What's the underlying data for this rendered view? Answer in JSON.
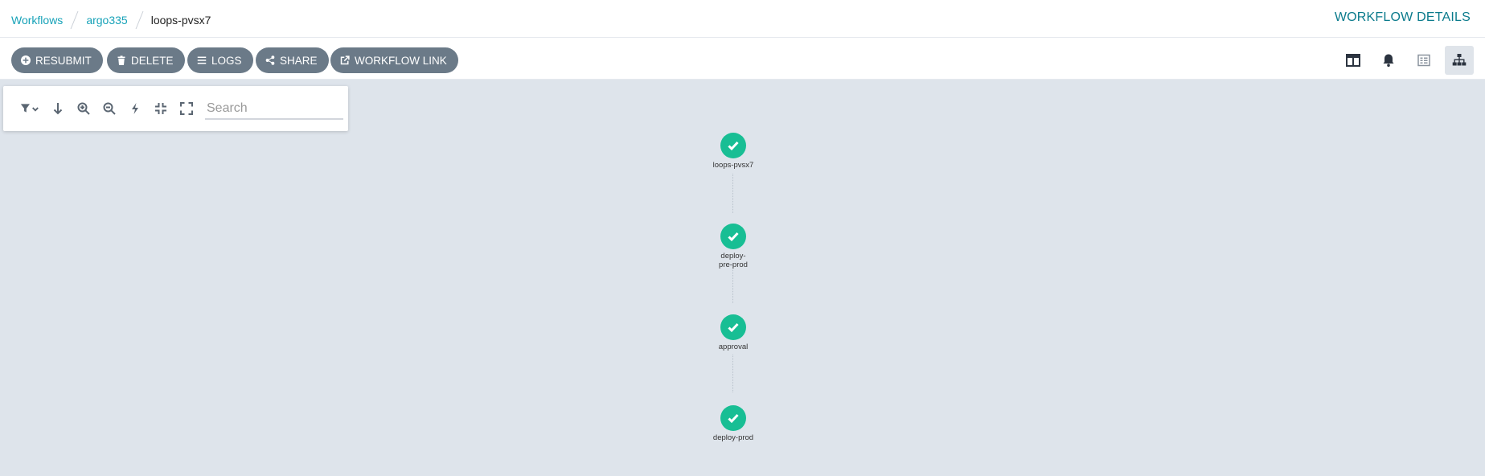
{
  "breadcrumb": {
    "items": [
      "Workflows",
      "argo335"
    ],
    "current": "loops-pvsx7"
  },
  "page_title": "WORKFLOW DETAILS",
  "toolbar": {
    "buttons": [
      {
        "label": "RESUBMIT",
        "icon": "plus-circle-icon"
      },
      {
        "label": "DELETE",
        "icon": "trash-icon"
      },
      {
        "label": "LOGS",
        "icon": "bars-icon"
      },
      {
        "label": "SHARE",
        "icon": "share-icon"
      },
      {
        "label": "WORKFLOW LINK",
        "icon": "external-link-icon"
      }
    ],
    "views": [
      {
        "name": "summary-view",
        "icon": "columns-icon",
        "active": false
      },
      {
        "name": "events-view",
        "icon": "bell-icon",
        "active": false
      },
      {
        "name": "timeline-view",
        "icon": "list-alt-icon",
        "active": false
      },
      {
        "name": "graph-view",
        "icon": "sitemap-icon",
        "active": true
      }
    ]
  },
  "graph_panel": {
    "icons": [
      "filter-icon",
      "arrow-down-icon",
      "zoom-in-icon",
      "zoom-out-icon",
      "bolt-icon",
      "compress-icon",
      "expand-icon"
    ],
    "search_placeholder": "Search"
  },
  "nodes": [
    {
      "label": "loops-pvsx7",
      "status": "succeeded"
    },
    {
      "label": "deploy-pre-prod",
      "status": "succeeded"
    },
    {
      "label": "approval",
      "status": "succeeded"
    },
    {
      "label": "deploy-prod",
      "status": "succeeded"
    }
  ],
  "colors": {
    "accent": "#17a2b8",
    "success": "#18be94",
    "button": "#6b7a88",
    "canvas": "#dee4eb"
  }
}
